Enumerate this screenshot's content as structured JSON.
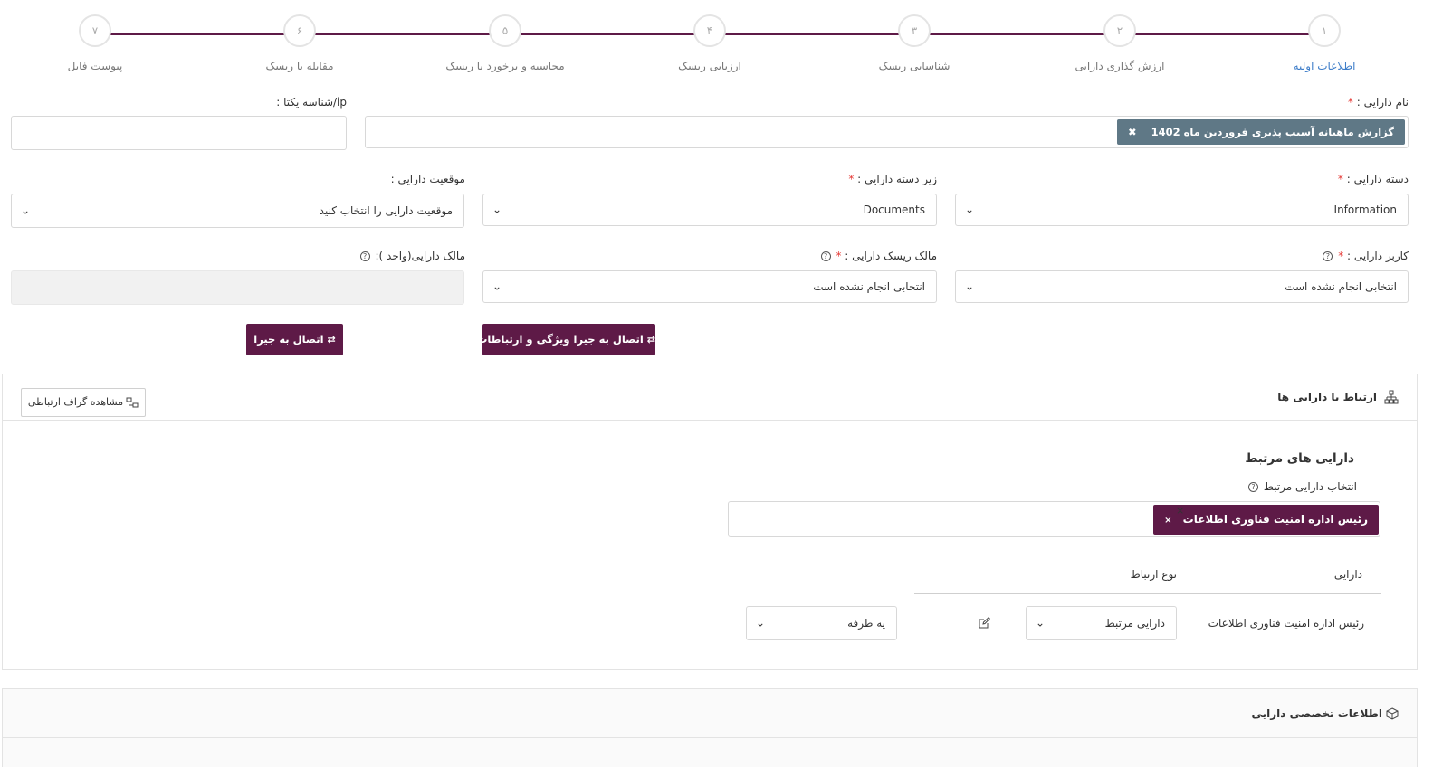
{
  "stepper": {
    "steps": [
      {
        "num": "۱",
        "label": "اطلاعات اولیه"
      },
      {
        "num": "۲",
        "label": "ارزش گذاری دارایی"
      },
      {
        "num": "۳",
        "label": "شناسایی ریسک"
      },
      {
        "num": "۴",
        "label": "ارزیابی ریسک"
      },
      {
        "num": "۵",
        "label": "محاسبه و برخورد با ریسک"
      },
      {
        "num": "۶",
        "label": "مقابله با ریسک"
      },
      {
        "num": "۷",
        "label": "پیوست فایل"
      }
    ],
    "active_index": 0,
    "active_color": "#3d7dc9",
    "line_color": "#5e1a47"
  },
  "form": {
    "asset_name_label": "نام دارایی :",
    "asset_name_tag": "گزارش ماهیانه آسیب پذیری فروردین ماه 1402",
    "asset_name_tag_remove": "✖",
    "unique_id_label": "ip/شناسه یکتا :",
    "unique_id_value": "",
    "category_label": "دسته دارایی :",
    "category_value": "Information",
    "subcategory_label": "زیر دسته دارایی :",
    "subcategory_value": "Documents",
    "location_label": "موقعیت دارایی :",
    "location_value": "موقعیت دارایی را انتخاب کنید",
    "user_label": "کاربر دارایی :",
    "user_value": "انتخابی انجام نشده است",
    "risk_owner_label": "مالک ریسک دارایی :",
    "risk_owner_value": "انتخابی انجام نشده است",
    "owner_unit_label": "مالک دارایی(واحد ):",
    "owner_unit_value": "",
    "required_mark": "*",
    "help_glyph": "?",
    "chevron": "⌄",
    "jira_features_button": "اتصال به جیرا ویژگی و ارتباطات",
    "jira_button": "اتصال به جیرا",
    "link_icon": "⇄"
  },
  "relations_panel": {
    "title": "ارتباط با دارایی ها",
    "title_icon": "sitemap-icon",
    "graph_button": "مشاهده گراف ارتباطی",
    "graph_icon": "graph-icon",
    "related_heading": "دارایی های مرتبط",
    "select_label": "انتخاب دارایی مرتبط",
    "selected_tag": "رئیس اداره امنیت فناوری اطلاعات",
    "tag_remove": "×",
    "clear_glyph": "×",
    "table": {
      "col_asset": "دارایی",
      "col_relation_type": "نوع ارتباط",
      "rows": [
        {
          "asset": "رئیس اداره امنیت فناوری اطلاعات",
          "relation_type": "دارایی مرتبط",
          "direction": "یه طرفه"
        }
      ]
    }
  },
  "specialized_panel": {
    "title": "اطلاعات تخصصی دارایی",
    "title_icon": "cube-icon"
  },
  "colors": {
    "brand_purple": "#5e1a47",
    "tag_gray": "#5f7886",
    "required_red": "#e53935"
  }
}
